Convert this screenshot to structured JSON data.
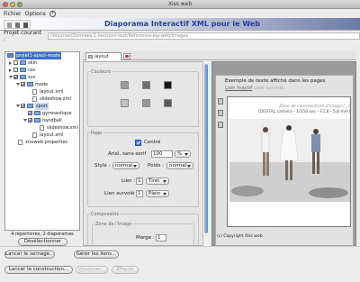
{
  "window": {
    "title": "Xiss web"
  },
  "menu": {
    "items": [
      "Fichier",
      "Options"
    ]
  },
  "banner": {
    "title": "Diaporama Interactif XML pour le Web"
  },
  "project": {
    "label": "Projet courant :",
    "path": "/Volumes/Donnees/1-test/xml-test/Reference-lay-web/images"
  },
  "tree": {
    "rows": [
      {
        "label": "projet1-xpsol-mode",
        "depth": 0,
        "kind": "root",
        "checked": true,
        "selected": true
      },
      {
        "label": "skin",
        "depth": 1,
        "kind": "folder",
        "checked": false,
        "closed": true
      },
      {
        "label": "css",
        "depth": 1,
        "kind": "folder",
        "checked": false,
        "closed": true
      },
      {
        "label": "xss",
        "depth": 1,
        "kind": "folder",
        "checked": true,
        "closed": false
      },
      {
        "label": "mode",
        "depth": 2,
        "kind": "folder",
        "checked": true,
        "closed": false
      },
      {
        "label": "layout.xml",
        "depth": 3,
        "kind": "file"
      },
      {
        "label": "slideshow.xml",
        "depth": 3,
        "kind": "file"
      },
      {
        "label": "sport",
        "depth": 2,
        "kind": "folder",
        "checked": true,
        "closed": false,
        "highlight": true
      },
      {
        "label": "gymnastique",
        "depth": 3,
        "kind": "folder",
        "checked": true
      },
      {
        "label": "handball",
        "depth": 3,
        "kind": "folder",
        "checked": true
      },
      {
        "label": "slideshow.xml",
        "depth": 4,
        "kind": "file"
      },
      {
        "label": "layout.xml",
        "depth": 3,
        "kind": "file"
      },
      {
        "label": "xissweb.properties",
        "depth": 1,
        "kind": "file"
      }
    ]
  },
  "left_panel": {
    "status": "4 répertoires, 2 diaporamas",
    "deselect_label": "Désélectionner"
  },
  "tab": {
    "label": "layout"
  },
  "properties": {
    "colors_title": "Couleurs",
    "swatches": [
      "#9a9a9a",
      "#6e6e6e",
      "#161616",
      "#c2c2c2",
      "#9a9a9a",
      "#5a5a5a"
    ],
    "page_title": "Page",
    "centered_label": "Centré",
    "font_name": "Arial, sans-serif",
    "font_size": "100",
    "font_unit": "%",
    "style_label": "Style :",
    "style_value": "normal",
    "weight_label": "Poids :",
    "weight_value": "normal",
    "link_label": "Lien :",
    "link_size": "1",
    "link_style": "Tiret",
    "hover_label": "Lien survolé :",
    "hover_size": "1",
    "hover_style": "Plein",
    "composants_title": "Composants",
    "zone_title": "Zone de l'image",
    "margin_label": "Marge :",
    "margin_value": "1"
  },
  "preview": {
    "heading": "Exemple de texte affiché dans les pages",
    "link_text": "Lien inactif",
    "link_hover": "Lien survolé",
    "caption": "Zone de commentaire d'image (...)",
    "info": "[DIGITAL camera - 1/350 sec - F2,8 - 5,8 mm]",
    "copyright": "(c) Copyright Xiss web"
  },
  "actions": {
    "launch_label": "Lancer le sernage...",
    "manage_links_label": "Gérer les liens...",
    "build_label": "Lancer la construction...",
    "preview_label": "Visionner...",
    "clear_label": "Effacer"
  }
}
